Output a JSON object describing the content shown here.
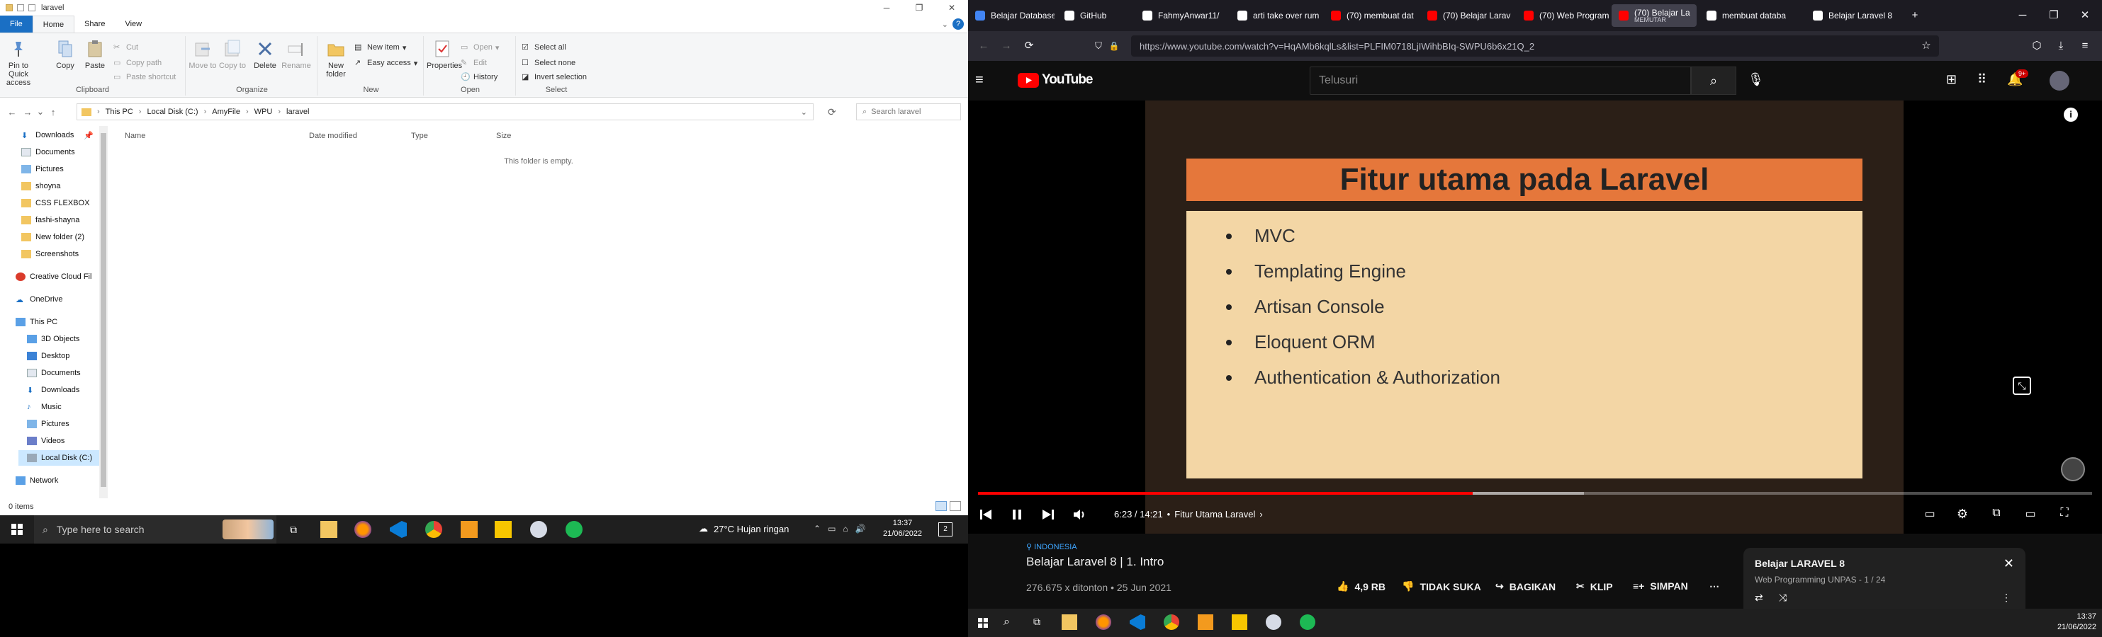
{
  "explorer": {
    "title": "laravel",
    "tabs": [
      "File",
      "Home",
      "Share",
      "View"
    ],
    "ribbon": {
      "clipboard": {
        "label": "Clipboard",
        "pin": "Pin to Quick access",
        "copy": "Copy",
        "paste": "Paste",
        "cut": "Cut",
        "copy_path": "Copy path",
        "paste_shortcut": "Paste shortcut"
      },
      "organize": {
        "label": "Organize",
        "move_to": "Move to",
        "copy_to": "Copy to",
        "delete": "Delete",
        "rename": "Rename"
      },
      "new": {
        "label": "New",
        "new_folder": "New folder",
        "new_item": "New item",
        "easy_access": "Easy access"
      },
      "open": {
        "label": "Open",
        "properties": "Properties",
        "open": "Open",
        "edit": "Edit",
        "history": "History"
      },
      "select": {
        "label": "Select",
        "select_all": "Select all",
        "select_none": "Select none",
        "invert": "Invert selection"
      }
    },
    "breadcrumb": [
      "This PC",
      "Local Disk (C:)",
      "AmyFile",
      "WPU",
      "laravel"
    ],
    "search_placeholder": "Search laravel",
    "nav": {
      "quick": [
        "Downloads",
        "Documents",
        "Pictures",
        "shoyna",
        "CSS FLEXBOX",
        "fashi-shayna",
        "New folder (2)",
        "Screenshots"
      ],
      "creative_cloud": "Creative Cloud Fil",
      "onedrive": "OneDrive",
      "this_pc": "This PC",
      "pc_items": [
        "3D Objects",
        "Desktop",
        "Documents",
        "Downloads",
        "Music",
        "Pictures",
        "Videos",
        "Local Disk (C:)"
      ],
      "network": "Network"
    },
    "columns": [
      "Name",
      "Date modified",
      "Type",
      "Size"
    ],
    "empty_message": "This folder is empty.",
    "status": "0 items"
  },
  "taskbar_left": {
    "search_placeholder": "Type here to search",
    "weather": "27°C  Hujan ringan",
    "time": "13:37",
    "date": "21/06/2022",
    "notif_count": "2"
  },
  "firefox": {
    "tabs": [
      {
        "label": "Belajar Database",
        "color": "#4285f4"
      },
      {
        "label": "GitHub",
        "color": "#ffffff"
      },
      {
        "label": "FahmyAnwar11/",
        "color": "#ffffff"
      },
      {
        "label": "arti take over rum",
        "color": "#ffffff"
      },
      {
        "label": "(70) membuat dat",
        "color": "#ff0000"
      },
      {
        "label": "(70) Belajar Larav",
        "color": "#ff0000"
      },
      {
        "label": "(70) Web Program",
        "color": "#ff0000"
      },
      {
        "label": "(70) Belajar La",
        "color": "#ff0000",
        "sub": "MEMUTAR"
      },
      {
        "label": "membuat databa",
        "color": "#ffffff"
      },
      {
        "label": "Belajar Laravel 8 |",
        "color": "#ffffff"
      }
    ],
    "url": "https://www.youtube.com/watch?v=HqAMb6kqlLs&list=PLFIM0718LjIWihbBIq-SWPU6b6x21Q_2"
  },
  "youtube": {
    "search_placeholder": "Telusuri",
    "notif_badge": "9+",
    "slide": {
      "title": "Fitur utama pada Laravel",
      "bullets": [
        "MVC",
        "Templating Engine",
        "Artisan Console",
        "Eloquent ORM",
        "Authentication & Authorization"
      ]
    },
    "progress": 0.444,
    "time_display": "6:23 / 14:21",
    "chapter": "Fitur Utama Laravel",
    "location_tag": "INDONESIA",
    "video_title": "Belajar Laravel 8 | 1. Intro",
    "meta": "276.675 x ditonton • 25 Jun 2021",
    "actions": {
      "like": "4,9 RB",
      "dislike": "TIDAK SUKA",
      "share": "BAGIKAN",
      "clip": "KLIP",
      "save": "SIMPAN"
    },
    "playlist": {
      "title": "Belajar LARAVEL 8",
      "sub": "Web Programming UNPAS - 1 / 24"
    }
  },
  "taskbar_right": {
    "time": "13:37",
    "date": "21/06/2022"
  },
  "colors": {
    "yt_red": "#ff0000",
    "explorer_blue": "#1a6fc4",
    "slide_orange": "#e5773b",
    "slide_cream": "#f3d6a5"
  }
}
